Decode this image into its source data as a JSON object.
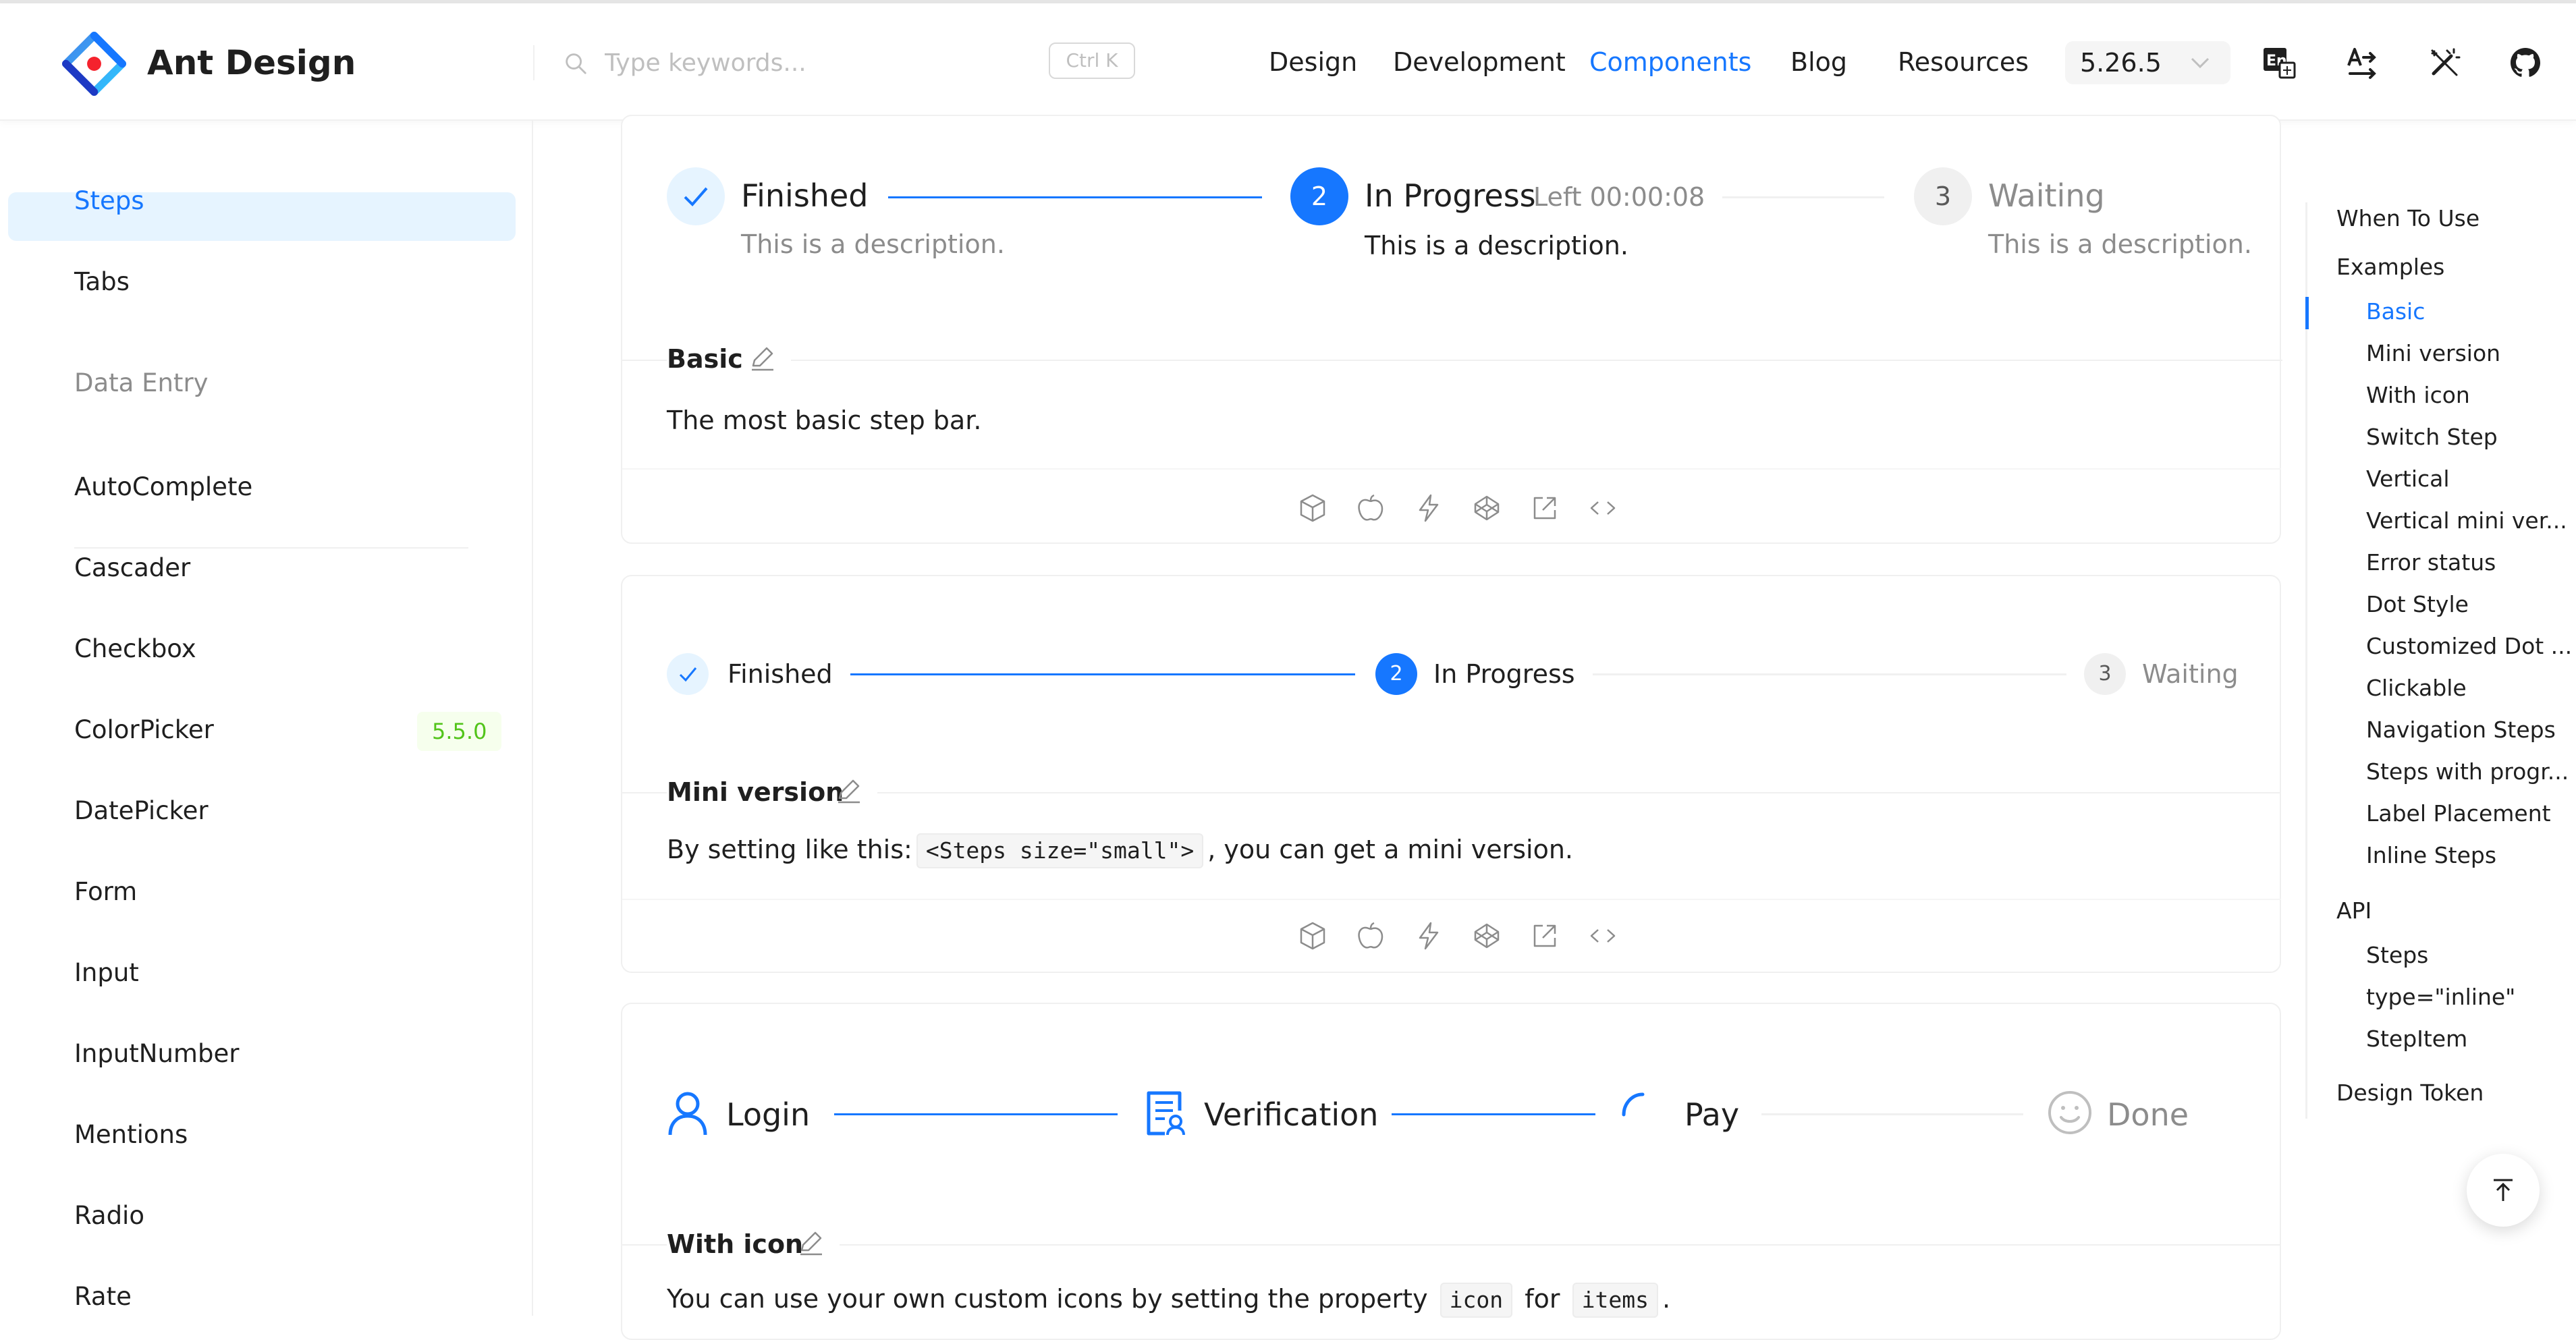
{
  "header": {
    "brand": "Ant Design",
    "search_placeholder": "Type keywords...",
    "shortcut": "Ctrl K",
    "nav": [
      "Design",
      "Development",
      "Components",
      "Blog",
      "Resources"
    ],
    "active_nav": "Components",
    "version": "5.26.5"
  },
  "sidebar": {
    "active_item": "Steps",
    "item_tabs": "Tabs",
    "group_label": "Data Entry",
    "items": [
      "AutoComplete",
      "Cascader",
      "Checkbox",
      "ColorPicker",
      "DatePicker",
      "Form",
      "Input",
      "InputNumber",
      "Mentions",
      "Radio",
      "Rate"
    ],
    "colorpicker_badge": "5.5.0"
  },
  "demo_basic": {
    "steps": [
      {
        "title": "Finished",
        "description": "This is a description.",
        "status": "finished"
      },
      {
        "title": "In Progress",
        "subtitle": "Left 00:00:08",
        "description": "This is a description.",
        "number": "2",
        "status": "process"
      },
      {
        "title": "Waiting",
        "description": "This is a description.",
        "number": "3",
        "status": "wait"
      }
    ],
    "title": "Basic",
    "description": "The most basic step bar."
  },
  "demo_mini": {
    "steps": [
      {
        "title": "Finished",
        "status": "finished"
      },
      {
        "title": "In Progress",
        "number": "2",
        "status": "process"
      },
      {
        "title": "Waiting",
        "number": "3",
        "status": "wait"
      }
    ],
    "title": "Mini version",
    "desc_before": "By setting like this:",
    "code": "<Steps size=\"small\">",
    "desc_after": ", you can get a mini version."
  },
  "demo_icon": {
    "steps": [
      {
        "title": "Login",
        "icon": "user-icon"
      },
      {
        "title": "Verification",
        "icon": "solution-icon"
      },
      {
        "title": "Pay",
        "icon": "loading-icon"
      },
      {
        "title": "Done",
        "icon": "smile-icon"
      }
    ],
    "title": "With icon",
    "desc_before": "You can use your own custom icons by setting the property",
    "code1": "icon",
    "desc_mid": "for",
    "code2": "items",
    "desc_after": "."
  },
  "anchor": {
    "when_to_use": "When To Use",
    "examples": "Examples",
    "example_items": [
      "Basic",
      "Mini version",
      "With icon",
      "Switch Step",
      "Vertical",
      "Vertical mini ver...",
      "Error status",
      "Dot Style",
      "Customized Dot ...",
      "Clickable",
      "Navigation Steps",
      "Steps with progr...",
      "Label Placement",
      "Inline Steps"
    ],
    "active": "Basic",
    "api": "API",
    "api_items": [
      "Steps",
      "type=\"inline\"",
      "StepItem"
    ],
    "design_token": "Design Token"
  },
  "colors": {
    "primary": "#1677ff",
    "primary_bg": "#e6f4ff",
    "text": "#1f1f1f",
    "secondary_text": "#8c8c8c",
    "badge_green": "#52c41a"
  }
}
